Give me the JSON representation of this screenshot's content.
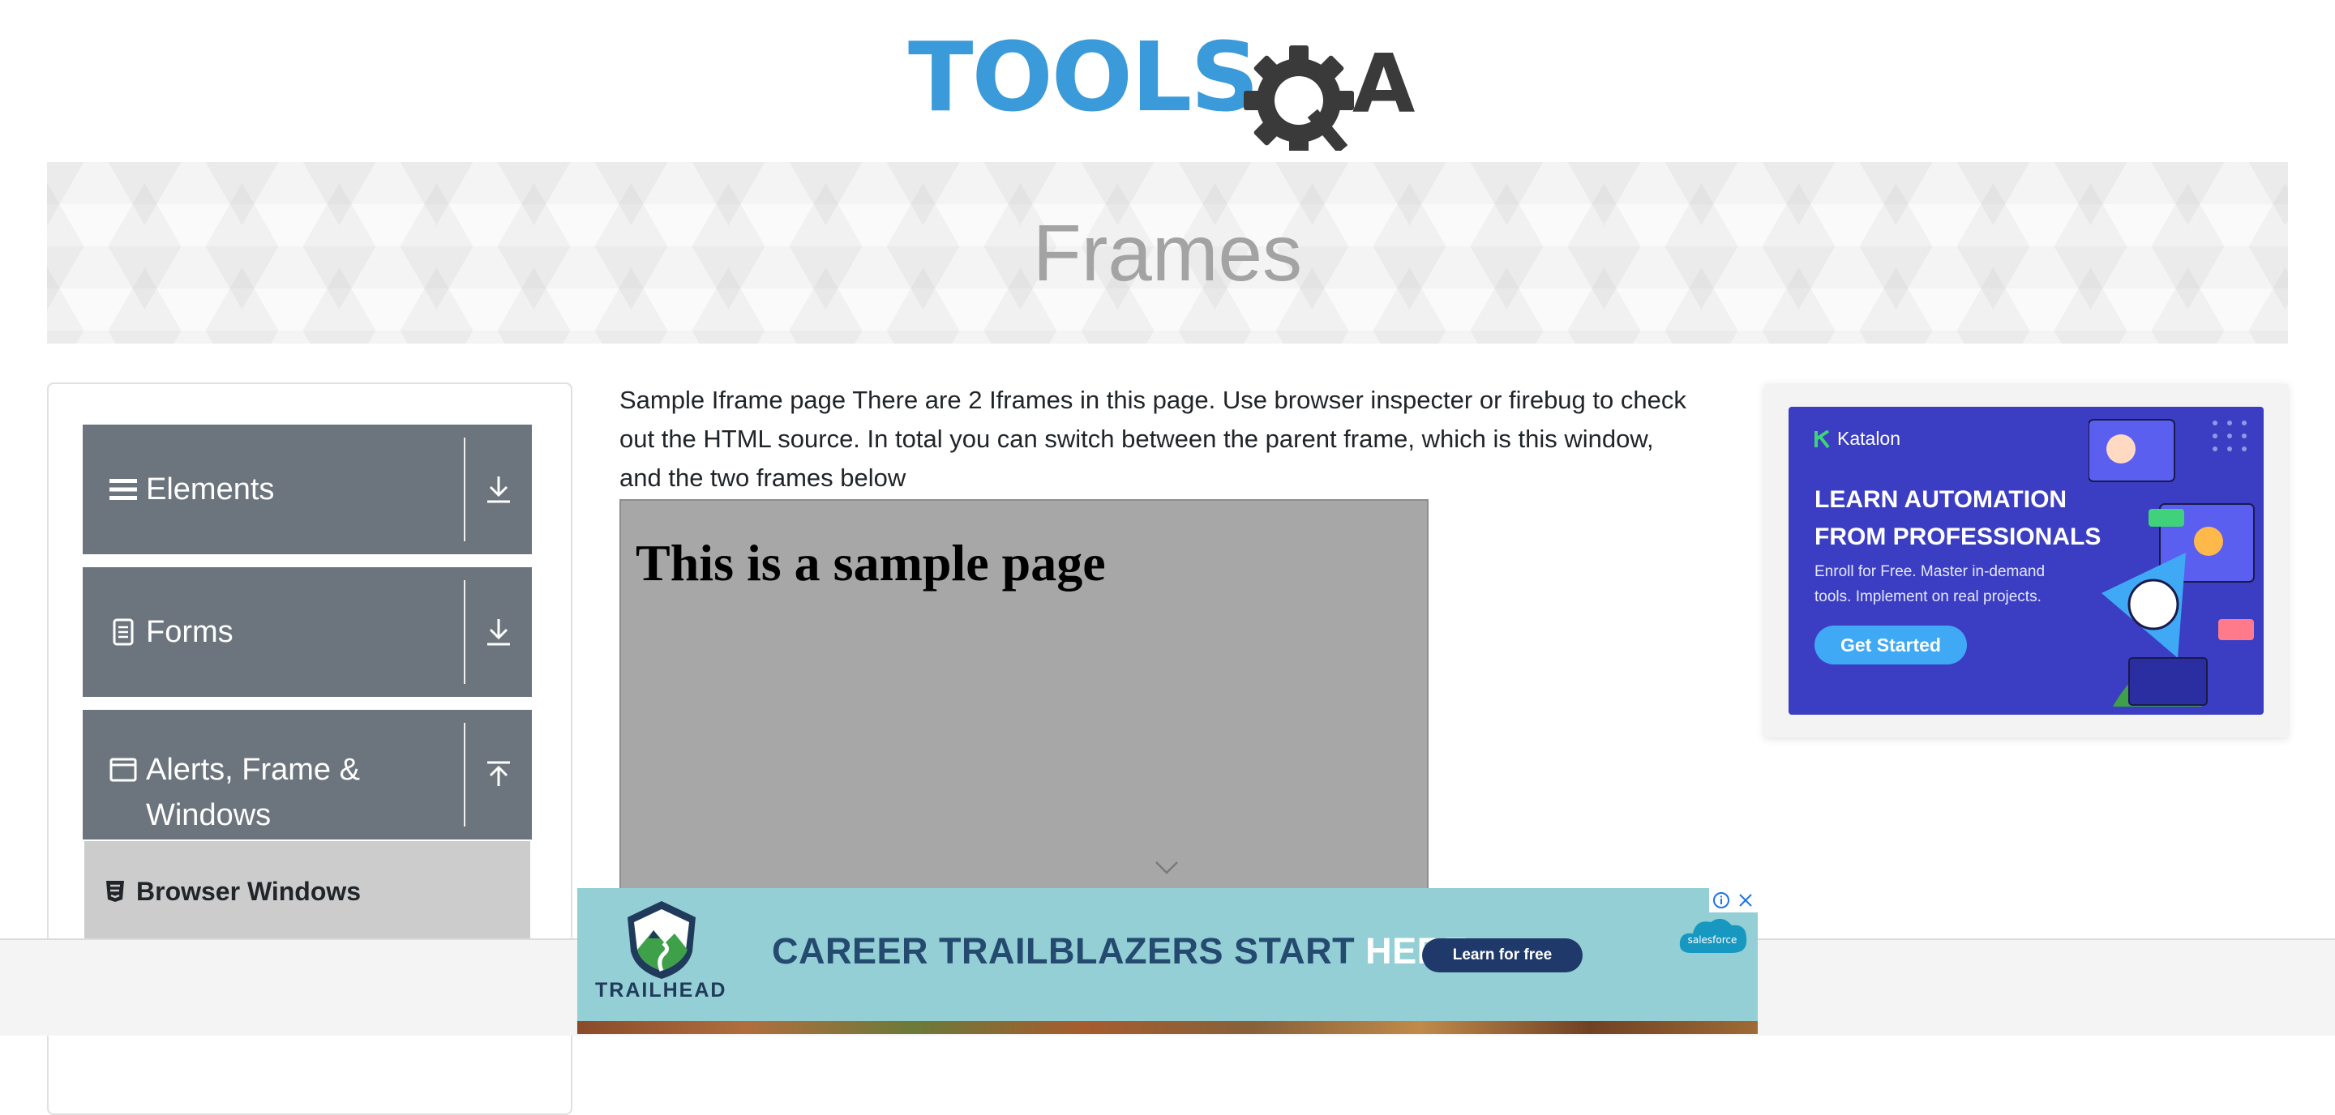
{
  "logo": {
    "text_blue": "TOOLS",
    "text_dark": "A"
  },
  "banner": {
    "title": "Frames"
  },
  "sidebar": {
    "groups": [
      {
        "label": "Elements",
        "icon": "hamburger-icon",
        "toggle_icon": "download-arrow-icon"
      },
      {
        "label": "Forms",
        "icon": "document-icon",
        "toggle_icon": "download-arrow-icon"
      },
      {
        "label_line1": "Alerts, Frame &",
        "label_line2": "Windows",
        "icon": "window-icon",
        "toggle_icon": "upload-arrow-icon"
      }
    ],
    "submenu": [
      {
        "label": "Browser Windows",
        "icon": "html5-icon"
      }
    ]
  },
  "content": {
    "intro": "Sample Iframe page There are 2 Iframes in this page. Use browser inspecter or firebug to check out the HTML source. In total you can switch between the parent frame, which is this window, and the two frames below",
    "iframe_heading": "This is a sample page"
  },
  "side_ad": {
    "brand": "Katalon",
    "headline_line1": "LEARN AUTOMATION",
    "headline_line2": "FROM PROFESSIONALS",
    "sub_line1": "Enroll for Free. Master in-demand",
    "sub_line2": "tools. Implement on real projects.",
    "cta": "Get Started",
    "bg_color": "#3b3ec2"
  },
  "bottom_ad": {
    "brand": "TRAILHEAD",
    "headline": "CAREER TRAILBLAZERS START",
    "headline_highlight": "HERE.",
    "cta": "Learn for free",
    "sponsor": "salesforce",
    "bg_color": "#93cfd4"
  },
  "colors": {
    "logo_blue": "#3b9ad9",
    "logo_dark": "#3a3a3a",
    "menu_bg": "#6c757d",
    "submenu_bg": "#cccccc"
  }
}
